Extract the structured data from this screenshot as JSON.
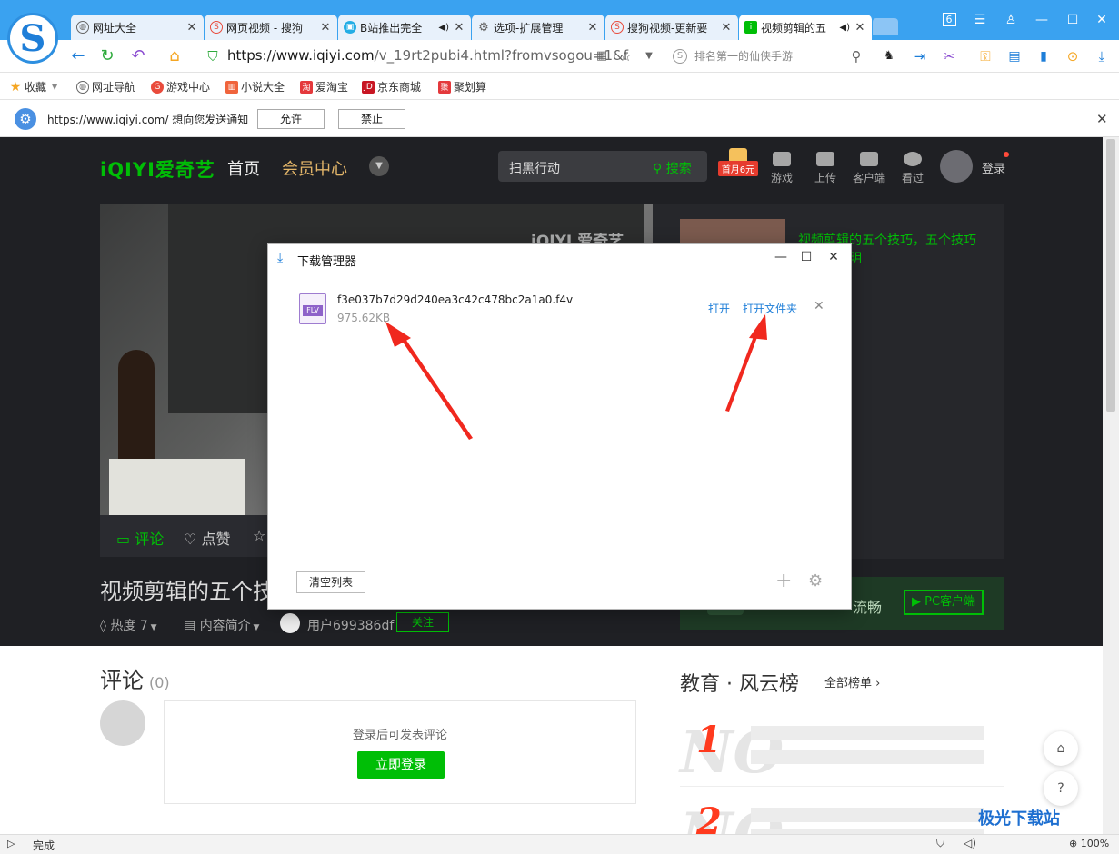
{
  "browser": {
    "tabs": [
      {
        "label": "网址大全",
        "icon": "globe-icon",
        "active": false
      },
      {
        "label": "网页视频 - 搜狗",
        "icon": "sogou-icon",
        "active": false
      },
      {
        "label": "B站推出完全",
        "icon": "bilibili-icon",
        "active": false
      },
      {
        "label": "选项-扩展管理",
        "icon": "gear-icon",
        "active": false
      },
      {
        "label": "搜狗视频-更新要",
        "icon": "sogou-icon",
        "active": false
      },
      {
        "label": "视频剪辑的五",
        "icon": "iqiyi-icon",
        "active": true
      }
    ],
    "tab_count": "6",
    "url_host": "https://www.iqiyi.com",
    "url_path": "/v_19rt2pubi4.html?fromvsogou=1&f",
    "search_placeholder": "排名第一的仙侠手游",
    "bookmarks": [
      "收藏",
      "网址导航",
      "游戏中心",
      "小说大全",
      "爱淘宝",
      "京东商城",
      "聚划算"
    ],
    "notification": {
      "text": "https://www.iqiyi.com/ 想向您发送通知",
      "allow": "允许",
      "deny": "禁止"
    },
    "status": "完成",
    "zoom": "100%"
  },
  "iqiyi": {
    "logo": "iQIYI爱奇艺",
    "nav_home": "首页",
    "nav_vip": "会员中心",
    "search_placeholder": "扫黑行动",
    "search_button": "搜索",
    "vip_badge": "首月6元",
    "top_icons": [
      "游戏",
      "上传",
      "客户端",
      "看过"
    ],
    "login": "登录",
    "video_watermark": "iQIYI 爱奇艺",
    "actions": [
      "评论",
      "点赞"
    ],
    "side_title": "视频剪辑的五个技巧，五个技巧",
    "side_title2": "明",
    "video_title": "视频剪辑的五个技",
    "heat": "热度 7",
    "intro": "内容简介",
    "user": "用户699386df",
    "follow": "关注",
    "pc_text": "流畅",
    "pc_button": "PC客户端",
    "comments_heading": "评论",
    "comments_count": "(0)",
    "comment_hint": "登录后可发表评论",
    "login_button": "立即登录",
    "rank_title": "教育 · 风云榜",
    "rank_all": "全部榜单 ›"
  },
  "download_manager": {
    "title": "下载管理器",
    "file_type": "FLV",
    "file_name": "f3e037b7d29d240ea3c42c478bc2a1a0.f4v",
    "file_size": "975.62KB",
    "open": "打开",
    "open_folder": "打开文件夹",
    "clear_list": "清空列表"
  },
  "watermark": "极光下载站"
}
